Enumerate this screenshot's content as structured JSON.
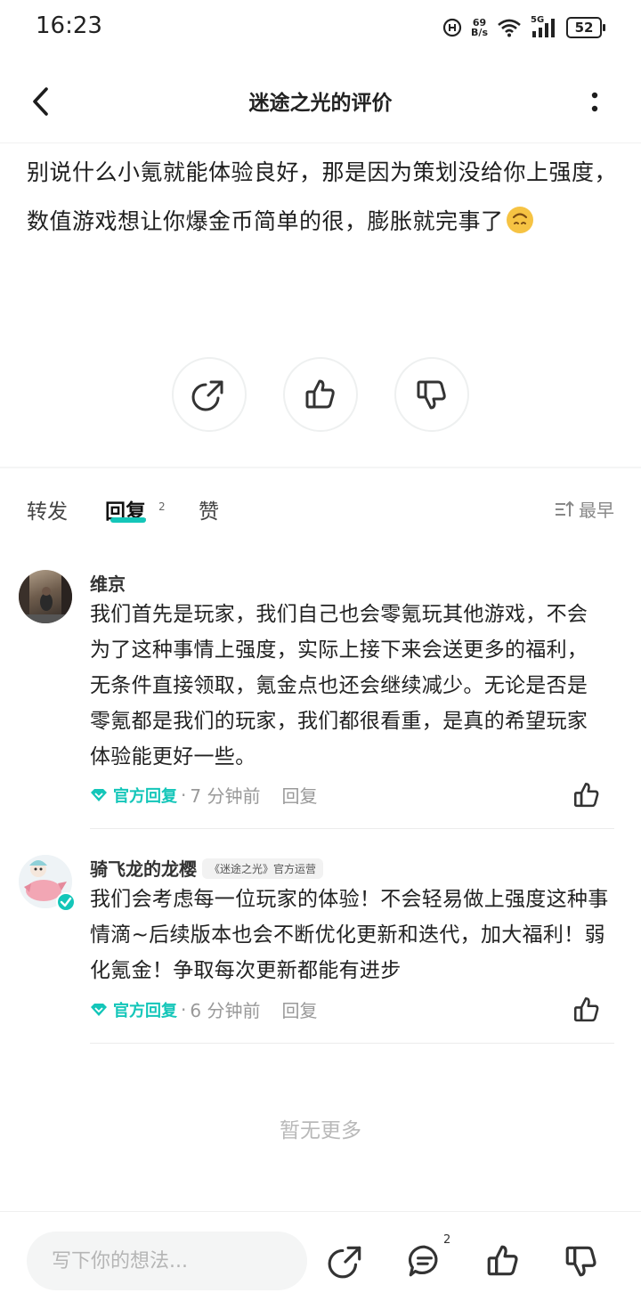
{
  "status_bar": {
    "time": "16:23",
    "net_speed_value": "69",
    "net_speed_unit": "B/s",
    "signal_label": "5G",
    "battery": "52"
  },
  "header": {
    "title": "迷途之光的评价"
  },
  "review": {
    "text": "别说什么小氪就能体验良好，那是因为策划没给你上强度，数值游戏想让你爆金币简单的很，膨胀就完事了",
    "emoji": "upside-down-face"
  },
  "tabs": [
    {
      "label": "转发"
    },
    {
      "label": "回复",
      "count": "2",
      "active": true
    },
    {
      "label": "赞"
    }
  ],
  "sort": {
    "label": "最早"
  },
  "comments": [
    {
      "author": "维京",
      "text": "我们首先是玩家，我们自己也会零氪玩其他游戏，不会为了这种事情上强度，实际上接下来会送更多的福利，无条件直接领取，氪金点也还会继续减少。无论是否是零氪都是我们的玩家，我们都很看重，是真的希望玩家体验能更好一些。",
      "official_label": "官方回复",
      "time": "7 分钟前",
      "reply_label": "回复"
    },
    {
      "author": "骑飞龙的龙樱",
      "badge": "《迷途之光》官方运营",
      "text": "我们会考虑每一位玩家的体验！不会轻易做上强度这种事情滴~后续版本也会不断优化更新和迭代，加大福利！弱化氪金！争取每次更新都能有进步",
      "official_label": "官方回复",
      "time": "6 分钟前",
      "reply_label": "回复"
    }
  ],
  "end_text": "暂无更多",
  "bottom_bar": {
    "input_placeholder": "写下你的想法...",
    "comment_count": "2"
  },
  "colors": {
    "accent": "#14c6b9",
    "text": "#1f1f1f",
    "muted": "#999999"
  }
}
